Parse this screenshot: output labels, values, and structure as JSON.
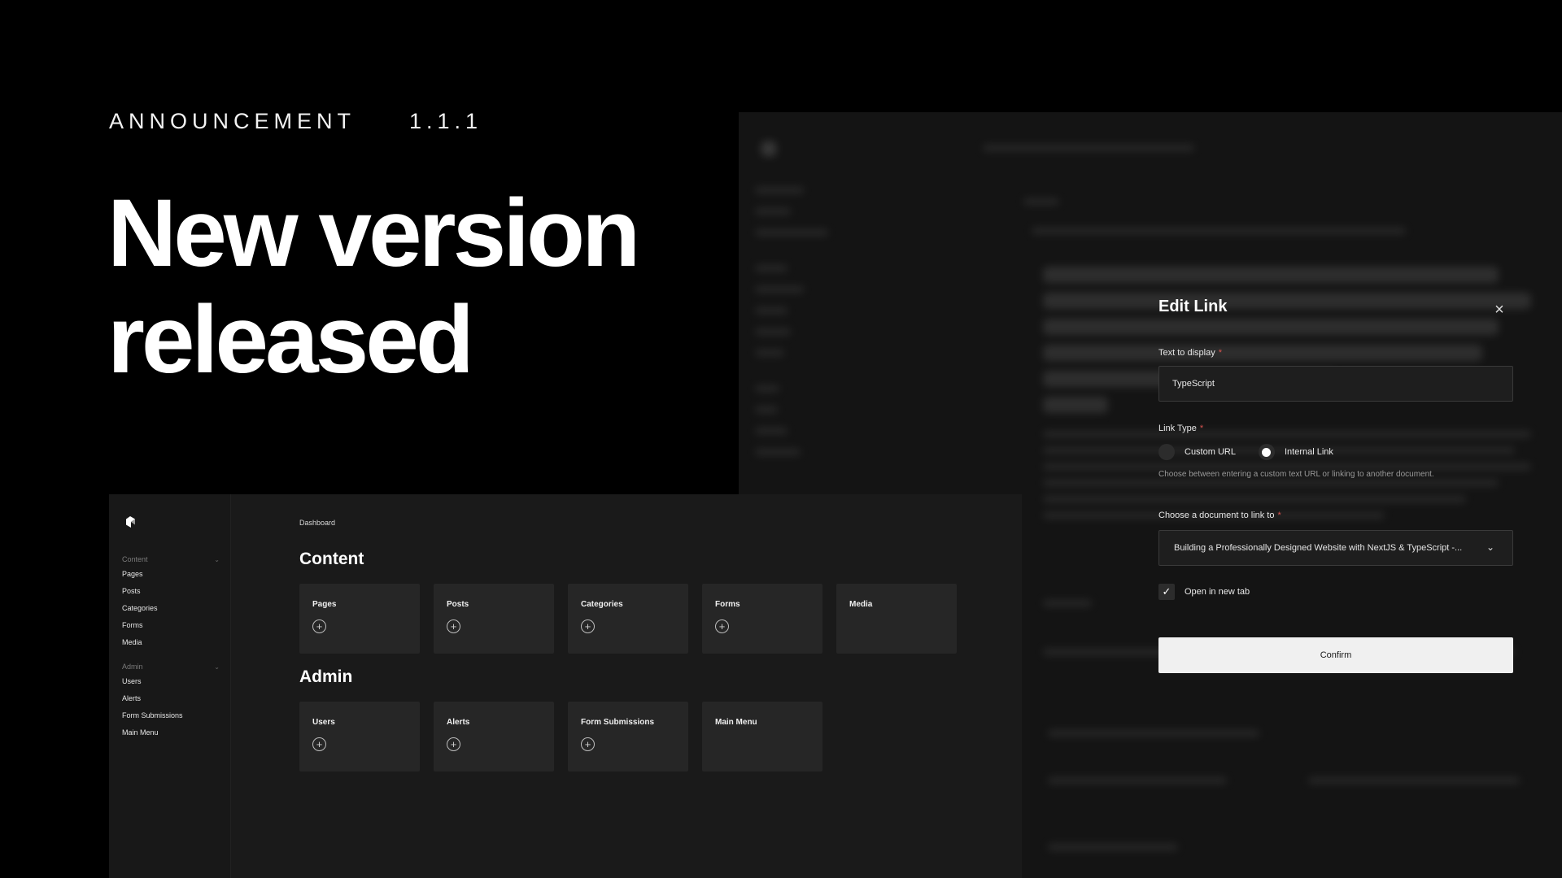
{
  "hero": {
    "eyebrow": "ANNOUNCEMENT",
    "version": "1.1.1",
    "title": "New version released"
  },
  "dashboard": {
    "sidebar": {
      "groups": [
        {
          "label": "Content",
          "items": [
            "Pages",
            "Posts",
            "Categories",
            "Forms",
            "Media"
          ]
        },
        {
          "label": "Admin",
          "items": [
            "Users",
            "Alerts",
            "Form Submissions",
            "Main Menu"
          ]
        }
      ]
    },
    "breadcrumb": "Dashboard",
    "sections": [
      {
        "title": "Content",
        "cards": [
          "Pages",
          "Posts",
          "Categories",
          "Forms",
          "Media"
        ],
        "add_icon_on": [
          true,
          true,
          true,
          true,
          false
        ]
      },
      {
        "title": "Admin",
        "cards": [
          "Users",
          "Alerts",
          "Form Submissions",
          "Main Menu"
        ],
        "add_icon_on": [
          true,
          true,
          true,
          false
        ]
      }
    ]
  },
  "modal": {
    "title": "Edit Link",
    "text_label": "Text to display",
    "text_value": "TypeScript",
    "link_type_label": "Link Type",
    "options": [
      {
        "label": "Custom URL",
        "selected": false
      },
      {
        "label": "Internal Link",
        "selected": true
      }
    ],
    "help": "Choose between entering a custom text URL or linking to another document.",
    "doc_label": "Choose a document to link to",
    "doc_value": "Building a Professionally Designed Website with NextJS & TypeScript -...",
    "new_tab_label": "Open in new tab",
    "new_tab_checked": true,
    "confirm_label": "Confirm",
    "required_mark": "*"
  },
  "icons": {
    "close": "close-icon",
    "check": "check-icon",
    "chevron": "chevron-down-icon",
    "add": "add-circle-icon",
    "logo": "payload-logo-icon"
  },
  "colors": {
    "background": "#000000",
    "panel": "#1a1a1a",
    "card": "#262626",
    "confirm": "#f0f0f0",
    "required": "#d9534f"
  }
}
